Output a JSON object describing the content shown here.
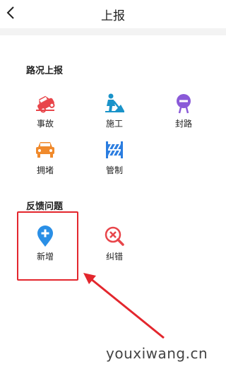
{
  "header": {
    "title": "上报"
  },
  "sections": {
    "road": {
      "title": "路况上报",
      "items": [
        {
          "label": "事故",
          "icon": "accident-car-icon",
          "color": "#e8454a"
        },
        {
          "label": "施工",
          "icon": "construction-worker-icon",
          "color": "#1a93c9"
        },
        {
          "label": "封路",
          "icon": "road-closed-icon",
          "color": "#8a5ad8"
        },
        {
          "label": "拥堵",
          "icon": "traffic-jam-icon",
          "color": "#f08a2c"
        },
        {
          "label": "管制",
          "icon": "traffic-control-barrier-icon",
          "color": "#2b7de0"
        }
      ]
    },
    "feedback": {
      "title": "反馈问题",
      "items": [
        {
          "label": "新增",
          "icon": "add-location-pin-icon",
          "color": "#2a8fe6"
        },
        {
          "label": "纠错",
          "icon": "error-correction-icon",
          "color": "#e8454a"
        }
      ]
    }
  },
  "watermark": "youxiwang.cn",
  "annotation_color": "#e3262d"
}
